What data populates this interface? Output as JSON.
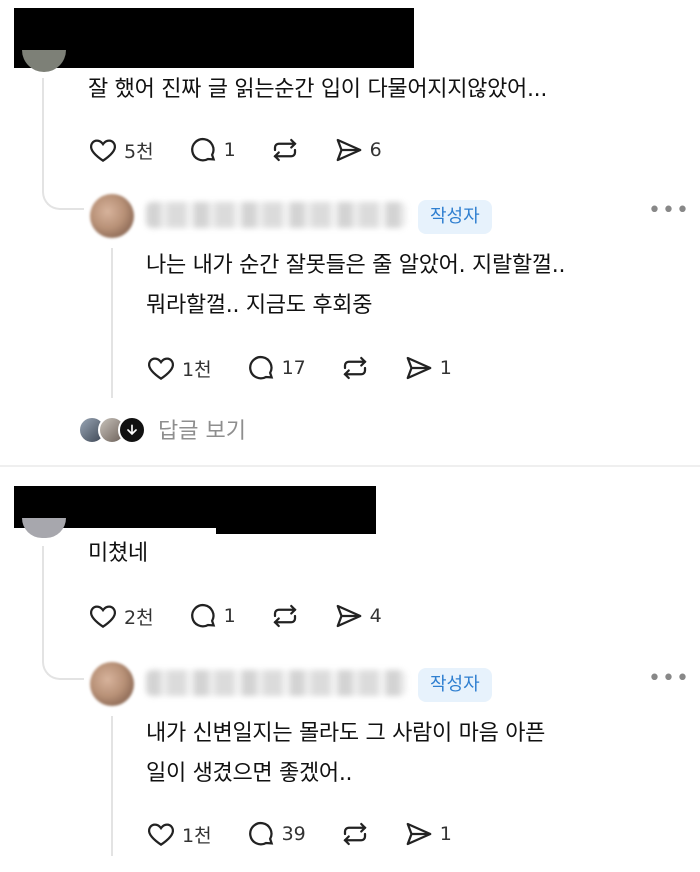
{
  "comments": [
    {
      "text": "잘 했어 진짜 글 읽는순간 입이 다물어지지않았어...",
      "likes": "5천",
      "replies": "1",
      "shares": "6",
      "reply": {
        "badge": "작성자",
        "text_line1": "나는 내가 순간 잘못들은 줄 알았어. 지랄할껄..",
        "text_line2": "뭐라할껄.. 지금도 후회중",
        "likes": "1천",
        "replies": "17",
        "shares": "1"
      },
      "see_replies": "답글 보기"
    },
    {
      "text": "미쳤네",
      "likes": "2천",
      "replies": "1",
      "shares": "4",
      "reply": {
        "badge": "작성자",
        "text_line1": "내가 신변일지는 몰라도 그 사람이 마음 아픈",
        "text_line2": "일이 생겼으면 좋겠어..",
        "likes": "1천",
        "replies": "39",
        "shares": "1"
      }
    }
  ],
  "more_label": "•••"
}
